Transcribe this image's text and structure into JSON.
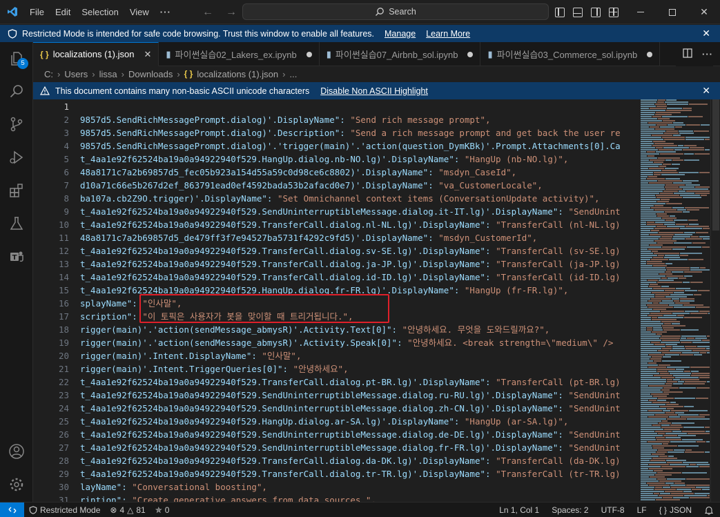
{
  "titlebar": {
    "menus": [
      "File",
      "Edit",
      "Selection",
      "View"
    ],
    "more": "···",
    "search_placeholder": "Search"
  },
  "restricted_banner": {
    "message": "Restricted Mode is intended for safe code browsing. Trust this window to enable all features.",
    "manage_link": "Manage",
    "learn_more_link": "Learn More"
  },
  "activity_bar": {
    "explorer_badge": "5"
  },
  "tabs": [
    {
      "label": "localizations (1).json",
      "type": "json",
      "active": true
    },
    {
      "label": "파이썬실습02_Lakers_ex.ipynb",
      "type": "notebook",
      "active": false
    },
    {
      "label": "파이썬실습07_Airbnb_sol.ipynb",
      "type": "notebook",
      "active": false
    },
    {
      "label": "파이썬실습03_Commerce_sol.ipynb",
      "type": "notebook",
      "active": false
    }
  ],
  "breadcrumb": [
    "C:",
    "Users",
    "lissa",
    "Downloads",
    "localizations (1).json",
    "..."
  ],
  "ascii_banner": {
    "message": "This document contains many non-basic ASCII unicode characters",
    "action": "Disable Non ASCII Highlight"
  },
  "editor": {
    "lines": [
      {
        "n": "1",
        "k": "",
        "s": ""
      },
      {
        "n": "2",
        "k": "9857d5.SendRichMessagePrompt.dialog)'.DisplayName\": ",
        "s": "\"Send rich message prompt\","
      },
      {
        "n": "3",
        "k": "9857d5.SendRichMessagePrompt.dialog)'.Description\": ",
        "s": "\"Send a rich message prompt and get back the user re"
      },
      {
        "n": "4",
        "k": "9857d5.SendRichMessagePrompt.dialog)'.'trigger(main)'.'action(question_DymKBk)'.Prompt.Attachments[0].Ca",
        "s": ""
      },
      {
        "n": "5",
        "k": "t_4aa1e92f62524ba19a0a94922940f529.HangUp.dialog.nb-NO.lg)'.DisplayName\": ",
        "s": "\"HangUp (nb-NO.lg)\","
      },
      {
        "n": "6",
        "k": "48a8171c7a2b69857d5_fec05b923a154d55a59c0d98ce6c8802)'.DisplayName\": ",
        "s": "\"msdyn_CaseId\","
      },
      {
        "n": "7",
        "k": "d10a71c66e5b267d2ef_863791ead0ef4592bada53b2afacd0e7)'.DisplayName\": ",
        "s": "\"va_CustomerLocale\","
      },
      {
        "n": "8",
        "k": "ba107a.cb2Z9O.trigger)'.DisplayName\": ",
        "s": "\"Set Omnichannel context items (ConversationUpdate activity)\","
      },
      {
        "n": "9",
        "k": "t_4aa1e92f62524ba19a0a94922940f529.SendUninterruptibleMessage.dialog.it-IT.lg)'.DisplayName\": ",
        "s": "\"SendUnint"
      },
      {
        "n": "10",
        "k": "t_4aa1e92f62524ba19a0a94922940f529.TransferCall.dialog.nl-NL.lg)'.DisplayName\": ",
        "s": "\"TransferCall (nl-NL.lg)"
      },
      {
        "n": "11",
        "k": "48a8171c7a2b69857d5_de479ff3f7e94527ba5731f4292c9fd5)'.DisplayName\": ",
        "s": "\"msdyn_CustomerId\","
      },
      {
        "n": "12",
        "k": "t_4aa1e92f62524ba19a0a94922940f529.TransferCall.dialog.sv-SE.lg)'.DisplayName\": ",
        "s": "\"TransferCall (sv-SE.lg)"
      },
      {
        "n": "13",
        "k": "t_4aa1e92f62524ba19a0a94922940f529.TransferCall.dialog.ja-JP.lg)'.DisplayName\": ",
        "s": "\"TransferCall (ja-JP.lg)"
      },
      {
        "n": "14",
        "k": "t_4aa1e92f62524ba19a0a94922940f529.TransferCall.dialog.id-ID.lg)'.DisplayName\": ",
        "s": "\"TransferCall (id-ID.lg)"
      },
      {
        "n": "15",
        "k": "t_4aa1e92f62524ba19a0a94922940f529.HangUp.dialog.fr-FR.lg)'.DisplayName\": ",
        "s": "\"HangUp (fr-FR.lg)\","
      },
      {
        "n": "16",
        "k": "splayName\": ",
        "s": "\"인사말\","
      },
      {
        "n": "17",
        "k": "scription\": ",
        "s": "\"이 토픽은 사용자가 봇을 맞이할 때 트리거됩니다.\","
      },
      {
        "n": "18",
        "k": "rigger(main)'.'action(sendMessage_abmysR)'.Activity.Text[0]\": ",
        "s": "\"안녕하세요. 무엇을 도와드릴까요?\","
      },
      {
        "n": "19",
        "k": "rigger(main)'.'action(sendMessage_abmysR)'.Activity.Speak[0]\": ",
        "s": "\"안녕하세요. <break strength=\\\"medium\\\" />"
      },
      {
        "n": "20",
        "k": "rigger(main)'.Intent.DisplayName\": ",
        "s": "\"인사말\","
      },
      {
        "n": "21",
        "k": "rigger(main)'.Intent.TriggerQueries[0]\": ",
        "s": "\"안녕하세요\","
      },
      {
        "n": "22",
        "k": "t_4aa1e92f62524ba19a0a94922940f529.TransferCall.dialog.pt-BR.lg)'.DisplayName\": ",
        "s": "\"TransferCall (pt-BR.lg)"
      },
      {
        "n": "23",
        "k": "t_4aa1e92f62524ba19a0a94922940f529.SendUninterruptibleMessage.dialog.ru-RU.lg)'.DisplayName\": ",
        "s": "\"SendUnint"
      },
      {
        "n": "24",
        "k": "t_4aa1e92f62524ba19a0a94922940f529.SendUninterruptibleMessage.dialog.zh-CN.lg)'.DisplayName\": ",
        "s": "\"SendUnint"
      },
      {
        "n": "25",
        "k": "t_4aa1e92f62524ba19a0a94922940f529.HangUp.dialog.ar-SA.lg)'.DisplayName\": ",
        "s": "\"HangUp (ar-SA.lg)\","
      },
      {
        "n": "26",
        "k": "t_4aa1e92f62524ba19a0a94922940f529.SendUninterruptibleMessage.dialog.de-DE.lg)'.DisplayName\": ",
        "s": "\"SendUnint"
      },
      {
        "n": "27",
        "k": "t_4aa1e92f62524ba19a0a94922940f529.SendUninterruptibleMessage.dialog.fr-FR.lg)'.DisplayName\": ",
        "s": "\"SendUnint"
      },
      {
        "n": "28",
        "k": "t_4aa1e92f62524ba19a0a94922940f529.TransferCall.dialog.da-DK.lg)'.DisplayName\": ",
        "s": "\"TransferCall (da-DK.lg)"
      },
      {
        "n": "29",
        "k": "t_4aa1e92f62524ba19a0a94922940f529.TransferCall.dialog.tr-TR.lg)'.DisplayName\": ",
        "s": "\"TransferCall (tr-TR.lg)"
      },
      {
        "n": "30",
        "k": "layName\": ",
        "s": "\"Conversational boosting\","
      },
      {
        "n": "31",
        "k": "rintion\": ",
        "s": "\"Create generative answers from data sources.\","
      }
    ]
  },
  "statusbar": {
    "restricted_mode": "Restricted Mode",
    "errors": "4",
    "warnings": "81",
    "ports": "0",
    "cursor": "Ln 1, Col 1",
    "spaces": "Spaces: 2",
    "encoding": "UTF-8",
    "eol": "LF",
    "language": "JSON"
  },
  "colors": {
    "accent": "#0078d4",
    "banner": "#0e3a66",
    "json_key": "#9cdcfe",
    "json_string": "#ce9178",
    "highlight_border": "#e0202a"
  }
}
